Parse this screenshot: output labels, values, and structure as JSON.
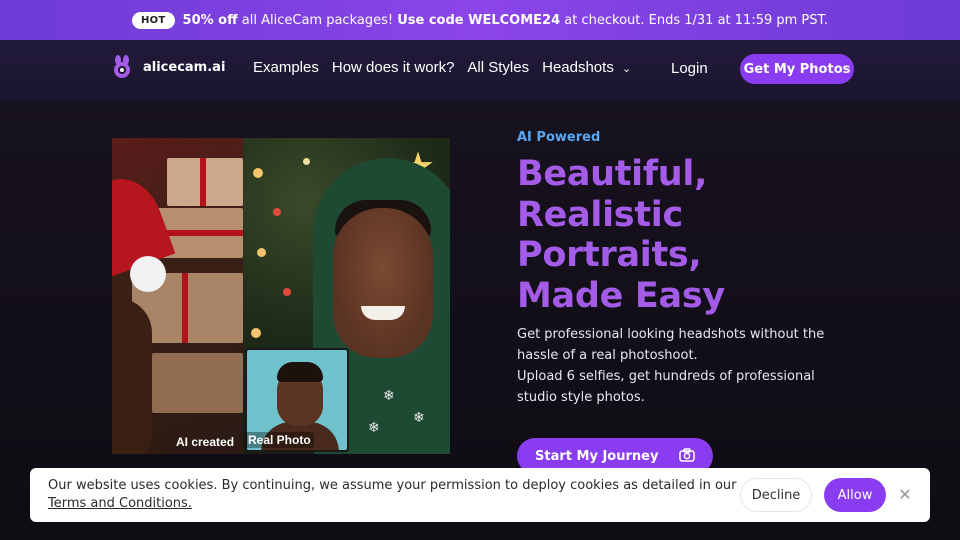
{
  "promo": {
    "badge": "HOT",
    "discount": "50% off",
    "text_mid": "all AliceCam packages!",
    "code_text": "Use code WELCOME24",
    "text_end": "at checkout. Ends 1/31 at 11:59 pm PST."
  },
  "nav": {
    "logo_text": "alicecam.ai",
    "links": [
      "Examples",
      "How does it work?",
      "All Styles",
      "Headshots"
    ],
    "login": "Login",
    "cta": "Get My Photos"
  },
  "hero": {
    "eyebrow": "AI Powered",
    "headline": [
      "Beautiful,",
      "Realistic",
      "Portraits,",
      "Made Easy"
    ],
    "desc1": "Get professional looking headshots without the hassle of a real photoshoot.",
    "desc2": "Upload 6 selfies, get hundreds of professional studio style photos.",
    "cta": "Start My Journey",
    "tag_ai": "AI created",
    "tag_real": "Real Photo"
  },
  "cookie": {
    "text": "Our website uses cookies. By continuing, we assume your permission to deploy cookies as detailed in our",
    "link": "Terms and Conditions.",
    "decline": "Decline",
    "allow": "Allow"
  },
  "colors": {
    "accent": "#8a3df0",
    "headline": "#a45ce8",
    "eyebrow": "#5aa7f0"
  },
  "icons": [
    "chevron-down-icon",
    "camera-icon",
    "close-icon",
    "logo-icon"
  ]
}
